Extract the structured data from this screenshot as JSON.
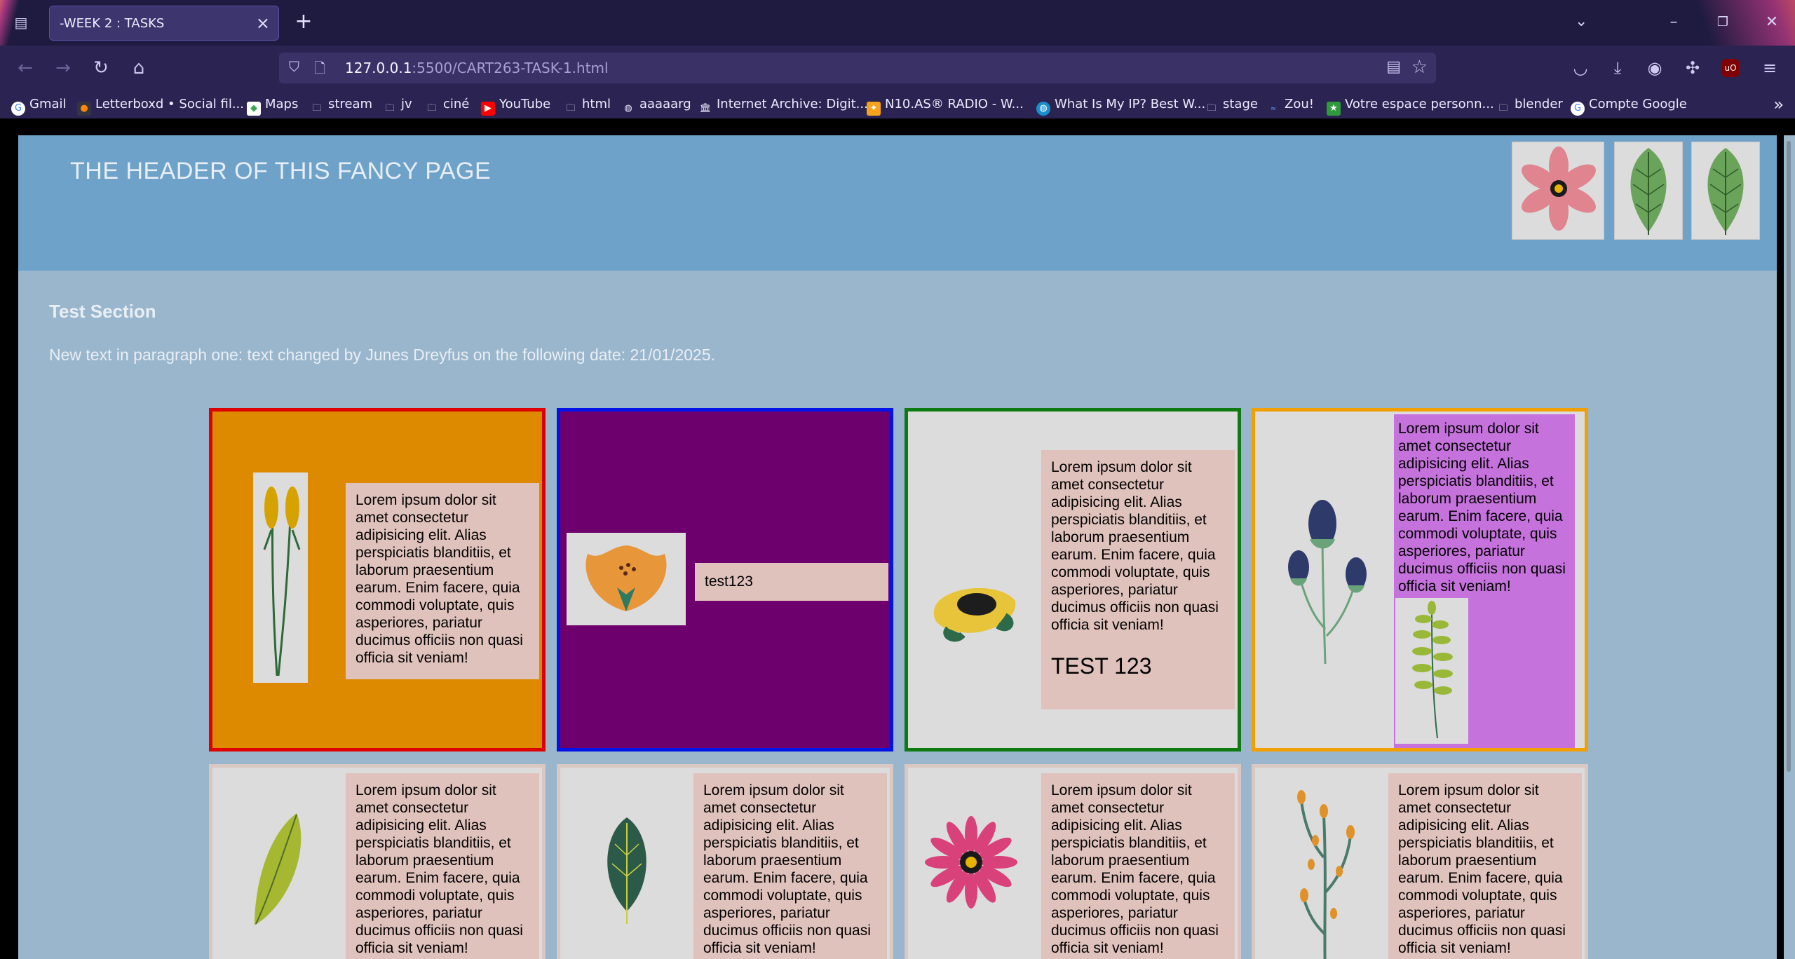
{
  "browser": {
    "tab_title": "-WEEK 2 : TASKS",
    "url_host": "127.0.0.1",
    "url_rest": ":5500/CART263-TASK-1.html",
    "bookmarks": [
      "Gmail",
      "Letterboxd • Social fil...",
      "Maps",
      "stream",
      "jv",
      "ciné",
      "YouTube",
      "html",
      "aaaaarg",
      "Internet Archive: Digit...",
      "N10.AS® RADIO - W...",
      "What Is My IP? Best W...",
      "stage",
      "Zou!",
      "Votre espace personn...",
      "blender",
      "Compte Google"
    ]
  },
  "page": {
    "header_title": "THE HEADER OF THIS FANCY PAGE",
    "section_title": "Test Section",
    "section_paragraph": "New text in paragraph one: text changed by Junes Dreyfus on the following date: 21/01/2025.",
    "lorem": "Lorem ipsum dolor sit amet consectetur adipisicing elit. Alias perspiciatis blanditiis, et laborum praesentium earum. Enim facere, quia commodi voluptate, quis asperiores, pariatur ducimus officiis non quasi officia sit veniam!",
    "card2_input_value": "test123",
    "card3_heading": "TEST 123"
  },
  "colors": {
    "card1_bg": "#dd8a00",
    "card1_border": "#dd0000",
    "card2_bg": "#6d006d",
    "card2_border": "#0014e8",
    "card3_bg": "#dcdcdc",
    "card3_border": "#0d7a12",
    "card4_bg": "#dcdcdc",
    "card4_border": "#f0a000",
    "card4_text_bg": "#c672dd"
  }
}
